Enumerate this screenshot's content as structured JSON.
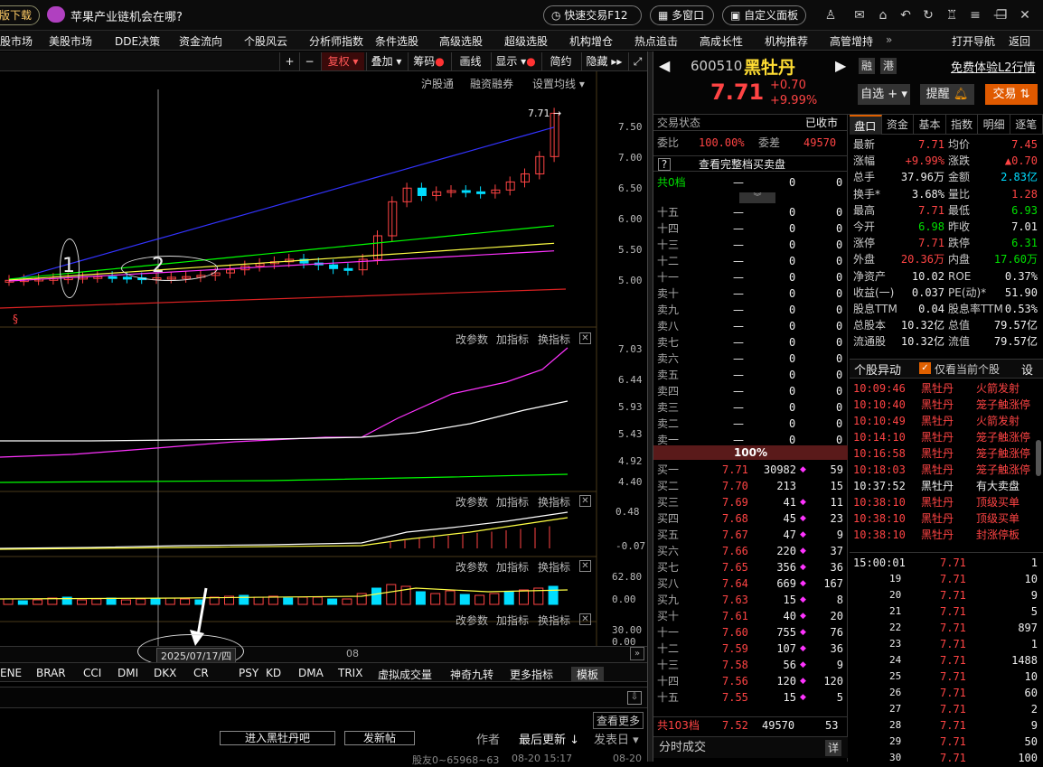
{
  "titlebar": {
    "download_label": "版下载",
    "promo_text": "苹果产业链机会在哪?",
    "quick_trade": "快速交易F12",
    "multi_window": "多窗口",
    "custom_panel": "自定义面板"
  },
  "menu": {
    "items": [
      "股市场",
      "美股市场",
      "DDE决策",
      "资金流向",
      "个股风云",
      "分析师指数",
      "条件选股",
      "高级选股",
      "超级选股",
      "机构增仓",
      "热点追击",
      "高成长性",
      "机构推荐",
      "高管增持"
    ],
    "more": "»",
    "open_nav": "打开导航",
    "back": "返回"
  },
  "toolbar": {
    "plus": "+",
    "minus": "−",
    "fuquan": "复权",
    "diejia": "叠加",
    "chouma": "筹码",
    "huaxian": "画线",
    "xianshi": "显示",
    "jianyue": "简约",
    "yincang": "隐藏"
  },
  "chart_header": {
    "hgt": "沪股通",
    "rzrq": "融资融券",
    "setma": "设置均线"
  },
  "price_panel": {
    "marker_label": "7.71",
    "yticks": [
      "7.50",
      "7.00",
      "6.50",
      "6.00",
      "5.50",
      "5.00"
    ],
    "flag": "§",
    "annot1": "1",
    "annot2": "2"
  },
  "panel2": {
    "change": "改参数",
    "add": "加指标",
    "swap": "换指标",
    "yticks": [
      "7.03",
      "6.44",
      "5.93",
      "5.43",
      "4.92",
      "4.40"
    ]
  },
  "panel3": {
    "change": "改参数",
    "add": "加指标",
    "swap": "换指标",
    "yticks": [
      "0.48",
      "-0.07"
    ]
  },
  "panel4": {
    "change": "改参数",
    "add": "加指标",
    "swap": "换指标",
    "yticks": [
      "62.80",
      "0.00"
    ]
  },
  "panel5": {
    "change": "改参数",
    "add": "加指标",
    "swap": "换指标",
    "yticks": [
      "30.00",
      "0.00"
    ]
  },
  "time_axis": {
    "cursor_date": "2025/07/17/四",
    "month": "08",
    "scroll": "»"
  },
  "indicators": [
    "ENE",
    "BRAR",
    "CCI",
    "DMI",
    "DKX",
    "CR",
    "PSY",
    "KD",
    "DMA",
    "TRIX",
    "虚拟成交量",
    "神奇九转",
    "更多指标",
    "模板"
  ],
  "forum": {
    "more": "查看更多",
    "enter": "进入黑牡丹吧",
    "post": "发新帖",
    "author": "作者",
    "last_update": "最后更新",
    "post_date": "发表日",
    "footer_text": "股友0~65968~63",
    "footer_time": "08-20 15:17",
    "footer_date": "08-20"
  },
  "stock": {
    "code": "600510",
    "name": "黑牡丹",
    "price": "7.71",
    "change": "+0.70",
    "change_pct": "+9.99%",
    "rong": "融",
    "gang": "港",
    "l2": "免费体验L2行情",
    "zixuan": "自选",
    "tixing": "提醒",
    "jiaoyi": "交易"
  },
  "orderbook": {
    "status_label": "交易状态",
    "status_value": "已收市",
    "weibi_label": "委比",
    "weibi_value": "100.00%",
    "weicha_label": "委差",
    "weicha_value": "49570",
    "full_depth": "查看完整档买卖盘",
    "top_label": "共0档",
    "top_v1": "—",
    "top_v2": "0",
    "top_v3": "0",
    "sells": [
      [
        "十五",
        "—",
        "0",
        "0"
      ],
      [
        "十四",
        "—",
        "0",
        "0"
      ],
      [
        "十三",
        "—",
        "0",
        "0"
      ],
      [
        "十二",
        "—",
        "0",
        "0"
      ],
      [
        "十一",
        "—",
        "0",
        "0"
      ],
      [
        "卖十",
        "—",
        "0",
        "0"
      ],
      [
        "卖九",
        "—",
        "0",
        "0"
      ],
      [
        "卖八",
        "—",
        "0",
        "0"
      ],
      [
        "卖七",
        "—",
        "0",
        "0"
      ],
      [
        "卖六",
        "—",
        "0",
        "0"
      ],
      [
        "卖五",
        "—",
        "0",
        "0"
      ],
      [
        "卖四",
        "—",
        "0",
        "0"
      ],
      [
        "卖三",
        "—",
        "0",
        "0"
      ],
      [
        "卖二",
        "—",
        "0",
        "0"
      ],
      [
        "卖一",
        "—",
        "0",
        "0"
      ]
    ],
    "ratio": "100%",
    "buys": [
      [
        "买一",
        "7.71",
        "30982",
        "◆",
        "59"
      ],
      [
        "买二",
        "7.70",
        "213",
        "",
        "15"
      ],
      [
        "买三",
        "7.69",
        "41",
        "◆",
        "11"
      ],
      [
        "买四",
        "7.68",
        "45",
        "◆",
        "23"
      ],
      [
        "买五",
        "7.67",
        "47",
        "◆",
        "9"
      ],
      [
        "买六",
        "7.66",
        "220",
        "◆",
        "37"
      ],
      [
        "买七",
        "7.65",
        "356",
        "◆",
        "36"
      ],
      [
        "买八",
        "7.64",
        "669",
        "◆",
        "167"
      ],
      [
        "买九",
        "7.63",
        "15",
        "◆",
        "8"
      ],
      [
        "买十",
        "7.61",
        "40",
        "◆",
        "20"
      ],
      [
        "十一",
        "7.60",
        "755",
        "◆",
        "76"
      ],
      [
        "十二",
        "7.59",
        "107",
        "◆",
        "36"
      ],
      [
        "十三",
        "7.58",
        "56",
        "◆",
        "9"
      ],
      [
        "十四",
        "7.56",
        "120",
        "◆",
        "120"
      ],
      [
        "十五",
        "7.55",
        "15",
        "◆",
        "5"
      ]
    ],
    "bottom": [
      "共103档",
      "7.52",
      "49570",
      "53"
    ],
    "timesales": "分时成交",
    "detail": "详"
  },
  "quote_tabs": [
    "盘口",
    "资金",
    "基本",
    "指数",
    "明细",
    "逐笔"
  ],
  "quote": [
    [
      "最新",
      "7.71",
      "均价",
      "7.45"
    ],
    [
      "涨幅",
      "+9.99%",
      "涨跌",
      "▲0.70"
    ],
    [
      "总手",
      "37.96万",
      "金额",
      "2.83亿"
    ],
    [
      "换手*",
      "3.68%",
      "量比",
      "1.28"
    ],
    [
      "最高",
      "7.71",
      "最低",
      "6.93"
    ],
    [
      "今开",
      "6.98",
      "昨收",
      "7.01"
    ],
    [
      "涨停",
      "7.71",
      "跌停",
      "6.31"
    ],
    [
      "外盘",
      "20.36万",
      "内盘",
      "17.60万"
    ],
    [
      "净资产",
      "10.02",
      "ROE",
      "0.37%"
    ],
    [
      "收益(一)",
      "0.037",
      "PE(动)*",
      "51.90"
    ],
    [
      "股息TTM",
      "0.04",
      "股息率TTM",
      "0.53%"
    ],
    [
      "总股本",
      "10.32亿",
      "总值",
      "79.57亿"
    ],
    [
      "流通股",
      "10.32亿",
      "流值",
      "79.57亿"
    ]
  ],
  "anomaly": {
    "title": "个股异动",
    "only_current": "仅看当前个股",
    "settings": "设",
    "rows": [
      [
        "10:09:46",
        "黑牡丹",
        "火箭发射"
      ],
      [
        "10:10:40",
        "黑牡丹",
        "笼子触涨停"
      ],
      [
        "10:10:49",
        "黑牡丹",
        "火箭发射"
      ],
      [
        "10:14:10",
        "黑牡丹",
        "笼子触涨停"
      ],
      [
        "10:16:58",
        "黑牡丹",
        "笼子触涨停"
      ],
      [
        "10:18:03",
        "黑牡丹",
        "笼子触涨停"
      ],
      [
        "10:37:52",
        "黑牡丹",
        "有大卖盘"
      ],
      [
        "10:38:10",
        "黑牡丹",
        "顶级买单"
      ],
      [
        "10:38:10",
        "黑牡丹",
        "顶级买单"
      ],
      [
        "10:38:10",
        "黑牡丹",
        "封涨停板"
      ]
    ]
  },
  "ticks": [
    [
      "15:00:01",
      "7.71",
      "1"
    ],
    [
      "19",
      "7.71",
      "10"
    ],
    [
      "20",
      "7.71",
      "9"
    ],
    [
      "21",
      "7.71",
      "5"
    ],
    [
      "22",
      "7.71",
      "897"
    ],
    [
      "23",
      "7.71",
      "1"
    ],
    [
      "24",
      "7.71",
      "1488"
    ],
    [
      "25",
      "7.71",
      "10"
    ],
    [
      "26",
      "7.71",
      "60"
    ],
    [
      "27",
      "7.71",
      "2"
    ],
    [
      "28",
      "7.71",
      "9"
    ],
    [
      "29",
      "7.71",
      "50"
    ],
    [
      "30",
      "7.71",
      "100"
    ]
  ],
  "colors": {
    "up": "#ff4444",
    "down": "#00ddff",
    "ma1": "#ffffff",
    "ma2": "#ffff44",
    "ma3": "#ff33ff",
    "ma4": "#00ff00",
    "ma5": "#3333ff",
    "ma6": "#dd2222"
  }
}
